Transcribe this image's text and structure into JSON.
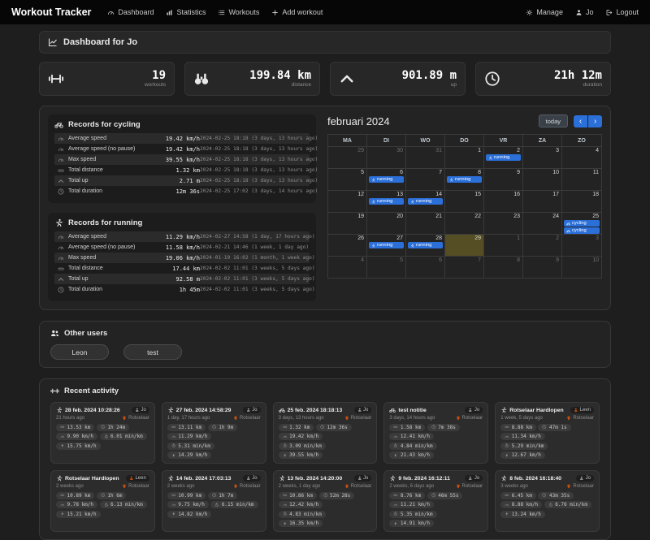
{
  "colors": {
    "accent": "#2b6fd9",
    "today_bg": "#554d23",
    "orange": "#e8590c",
    "navbar_bg": "#060606"
  },
  "navbar": {
    "brand": "Workout Tracker",
    "items": [
      {
        "label": "Dashboard",
        "icon": "gauge-icon"
      },
      {
        "label": "Statistics",
        "icon": "bar-chart-icon"
      },
      {
        "label": "Workouts",
        "icon": "list-icon"
      },
      {
        "label": "Add workout",
        "icon": "plus-icon"
      }
    ],
    "right_items": [
      {
        "label": "Manage",
        "icon": "gear-icon"
      },
      {
        "label": "Jo",
        "icon": "person-icon"
      },
      {
        "label": "Logout",
        "icon": "logout-icon"
      }
    ]
  },
  "page_header": {
    "title": "Dashboard for Jo",
    "icon": "chart-line-icon"
  },
  "stats": [
    {
      "icon": "dumbbell-icon",
      "value": "19",
      "label": "workouts"
    },
    {
      "icon": "binoculars-icon",
      "value": "199.84 km",
      "label": "distance"
    },
    {
      "icon": "chevron-up-icon",
      "value": "901.89 m",
      "label": "up"
    },
    {
      "icon": "clock-icon",
      "value": "21h 12m",
      "label": "duration"
    }
  ],
  "records": [
    {
      "title": "Records for cycling",
      "icon": "bike-icon",
      "rows": [
        {
          "icon": "gauge-icon",
          "label": "Average speed",
          "value": "19.42 km/h",
          "when": "2024-02-25 18:18 (3 days, 13 hours ago)"
        },
        {
          "icon": "gauge-icon",
          "label": "Average speed (no pause)",
          "value": "19.42 km/h",
          "when": "2024-02-25 18:18 (3 days, 13 hours ago)"
        },
        {
          "icon": "gauge-icon",
          "label": "Max speed",
          "value": "39.55 km/h",
          "when": "2024-02-25 18:18 (3 days, 13 hours ago)"
        },
        {
          "icon": "ruler-icon",
          "label": "Total distance",
          "value": "1.32 km",
          "when": "2024-02-25 18:18 (3 days, 13 hours ago)"
        },
        {
          "icon": "chevron-up-icon",
          "label": "Total up",
          "value": "2.71 m",
          "when": "2024-02-25 18:18 (3 days, 13 hours ago)"
        },
        {
          "icon": "clock-icon",
          "label": "Total duration",
          "value": "12m 36s",
          "when": "2024-02-25 17:02 (3 days, 14 hours ago)"
        }
      ]
    },
    {
      "title": "Records for running",
      "icon": "runner-icon",
      "rows": [
        {
          "icon": "gauge-icon",
          "label": "Average speed",
          "value": "11.29 km/h",
          "when": "2024-02-27 14:58 (1 day, 17 hours ago)"
        },
        {
          "icon": "gauge-icon",
          "label": "Average speed (no pause)",
          "value": "11.58 km/h",
          "when": "2024-02-21 14:46 (1 week, 1 day ago)"
        },
        {
          "icon": "gauge-icon",
          "label": "Max speed",
          "value": "19.06 km/h",
          "when": "2024-01-19 16:02 (1 month, 1 week ago)"
        },
        {
          "icon": "ruler-icon",
          "label": "Total distance",
          "value": "17.44 km",
          "when": "2024-02-02 11:01 (3 weeks, 5 days ago)"
        },
        {
          "icon": "chevron-up-icon",
          "label": "Total up",
          "value": "92.58 m",
          "when": "2024-02-02 11:01 (3 weeks, 5 days ago)"
        },
        {
          "icon": "clock-icon",
          "label": "Total duration",
          "value": "1h 45m",
          "when": "2024-02-02 11:01 (3 weeks, 5 days ago)"
        }
      ]
    }
  ],
  "calendar": {
    "title": "februari 2024",
    "today_label": "today",
    "prev_label": "‹",
    "next_label": "›",
    "weekdays": [
      "MA",
      "DI",
      "WO",
      "DO",
      "VR",
      "ZA",
      "ZO"
    ],
    "days": [
      {
        "day": 29,
        "out": true
      },
      {
        "day": 30,
        "out": true
      },
      {
        "day": 31,
        "out": true
      },
      {
        "day": 1
      },
      {
        "day": 2,
        "events": [
          {
            "icon": "runner-icon",
            "label": "running"
          }
        ]
      },
      {
        "day": 3
      },
      {
        "day": 4
      },
      {
        "day": 5
      },
      {
        "day": 6,
        "events": [
          {
            "icon": "runner-icon",
            "label": "running"
          }
        ]
      },
      {
        "day": 7
      },
      {
        "day": 8,
        "events": [
          {
            "icon": "runner-icon",
            "label": "running"
          }
        ]
      },
      {
        "day": 9
      },
      {
        "day": 10
      },
      {
        "day": 11
      },
      {
        "day": 12
      },
      {
        "day": 13,
        "events": [
          {
            "icon": "runner-icon",
            "label": "running"
          }
        ]
      },
      {
        "day": 14,
        "events": [
          {
            "icon": "runner-icon",
            "label": "running"
          }
        ]
      },
      {
        "day": 15
      },
      {
        "day": 16
      },
      {
        "day": 17
      },
      {
        "day": 18
      },
      {
        "day": 19
      },
      {
        "day": 20
      },
      {
        "day": 21
      },
      {
        "day": 22
      },
      {
        "day": 23
      },
      {
        "day": 24
      },
      {
        "day": 25,
        "events": [
          {
            "icon": "bike-icon",
            "label": "cycling"
          },
          {
            "icon": "bike-icon",
            "label": "cycling"
          }
        ]
      },
      {
        "day": 26
      },
      {
        "day": 27,
        "events": [
          {
            "icon": "runner-icon",
            "label": "running"
          }
        ]
      },
      {
        "day": 28,
        "events": [
          {
            "icon": "runner-icon",
            "label": "running"
          }
        ]
      },
      {
        "day": 29,
        "today": true
      },
      {
        "day": 1,
        "out": true
      },
      {
        "day": 2,
        "out": true
      },
      {
        "day": 3,
        "out": true
      },
      {
        "day": 4,
        "out": true
      },
      {
        "day": 5,
        "out": true
      },
      {
        "day": 6,
        "out": true
      },
      {
        "day": 7,
        "out": true
      },
      {
        "day": 8,
        "out": true
      },
      {
        "day": 9,
        "out": true
      },
      {
        "day": 10,
        "out": true
      }
    ]
  },
  "other_users": {
    "title": "Other users",
    "icon": "people-icon",
    "users": [
      "Leon",
      "test"
    ]
  },
  "recent": {
    "title": "Recent activity",
    "icon": "dumbbell-icon",
    "cards": [
      {
        "type_icon": "runner-icon",
        "title": "28 feb. 2024 10:28:26",
        "user": "Jo",
        "user_color": "#b0b0b0",
        "ago": "21 hours ago",
        "location": "Rotselaar",
        "chips": [
          {
            "icon": "ruler-icon",
            "text": "13.53 km"
          },
          {
            "icon": "clock-icon",
            "text": "1h 24m"
          },
          {
            "icon": "gauge-icon",
            "text": "9.90 km/h"
          },
          {
            "icon": "stopwatch-icon",
            "text": "6.01 min/km"
          },
          {
            "icon": "bolt-icon",
            "text": "15.75 km/h"
          }
        ]
      },
      {
        "type_icon": "runner-icon",
        "title": "27 feb. 2024 14:58:29",
        "user": "Jo",
        "user_color": "#b0b0b0",
        "ago": "1 day, 17 hours ago",
        "location": "Rotselaar",
        "chips": [
          {
            "icon": "ruler-icon",
            "text": "13.11 km"
          },
          {
            "icon": "clock-icon",
            "text": "1h 9m"
          },
          {
            "icon": "gauge-icon",
            "text": "11.29 km/h"
          },
          {
            "icon": "stopwatch-icon",
            "text": "5.31 min/km"
          },
          {
            "icon": "bolt-icon",
            "text": "14.29 km/h"
          }
        ]
      },
      {
        "type_icon": "bike-icon",
        "title": "25 feb. 2024 18:18:13",
        "user": "Jo",
        "user_color": "#b0b0b0",
        "ago": "3 days, 13 hours ago",
        "location": "Rotselaar",
        "chips": [
          {
            "icon": "ruler-icon",
            "text": "1.32 km"
          },
          {
            "icon": "clock-icon",
            "text": "12m 36s"
          },
          {
            "icon": "gauge-icon",
            "text": "19.42 km/h"
          },
          {
            "icon": "stopwatch-icon",
            "text": "3.09 min/km"
          },
          {
            "icon": "bolt-icon",
            "text": "39.55 km/h"
          }
        ]
      },
      {
        "type_icon": "bike-icon",
        "title": "test notitie",
        "user": "Jo",
        "user_color": "#b0b0b0",
        "ago": "3 days, 14 hours ago",
        "location": "Rotselaar",
        "chips": [
          {
            "icon": "ruler-icon",
            "text": "1.58 km"
          },
          {
            "icon": "clock-icon",
            "text": "7m 38s"
          },
          {
            "icon": "gauge-icon",
            "text": "12.41 km/h"
          },
          {
            "icon": "stopwatch-icon",
            "text": "4.84 min/km"
          },
          {
            "icon": "bolt-icon",
            "text": "21.43 km/h"
          }
        ]
      },
      {
        "type_icon": "runner-icon",
        "title": "Rotselaar Hardlopen",
        "user": "Leen",
        "user_color": "#e8590c",
        "ago": "1 week, 5 days ago",
        "location": "Rotselaar",
        "chips": [
          {
            "icon": "ruler-icon",
            "text": "8.88 km"
          },
          {
            "icon": "clock-icon",
            "text": "47m 1s"
          },
          {
            "icon": "gauge-icon",
            "text": "11.34 km/h"
          },
          {
            "icon": "stopwatch-icon",
            "text": "5.29 min/km"
          },
          {
            "icon": "bolt-icon",
            "text": "12.67 km/h"
          }
        ]
      },
      {
        "type_icon": "runner-icon",
        "title": "Rotselaar Hardlopen",
        "user": "Leen",
        "user_color": "#e8590c",
        "ago": "2 weeks ago",
        "location": "Rotselaar",
        "chips": [
          {
            "icon": "ruler-icon",
            "text": "10.89 km"
          },
          {
            "icon": "clock-icon",
            "text": "1h 6m"
          },
          {
            "icon": "gauge-icon",
            "text": "9.78 km/h"
          },
          {
            "icon": "stopwatch-icon",
            "text": "6.13 min/km"
          },
          {
            "icon": "bolt-icon",
            "text": "15.21 km/h"
          }
        ]
      },
      {
        "type_icon": "runner-icon",
        "title": "14 feb. 2024 17:03:13",
        "user": "Jo",
        "user_color": "#b0b0b0",
        "ago": "2 weeks ago",
        "location": "Rotselaar",
        "chips": [
          {
            "icon": "ruler-icon",
            "text": "10.99 km"
          },
          {
            "icon": "clock-icon",
            "text": "1h 7m"
          },
          {
            "icon": "gauge-icon",
            "text": "9.75 km/h"
          },
          {
            "icon": "stopwatch-icon",
            "text": "6.15 min/km"
          },
          {
            "icon": "bolt-icon",
            "text": "14.82 km/h"
          }
        ]
      },
      {
        "type_icon": "runner-icon",
        "title": "13 feb. 2024 14:20:00",
        "user": "Jo",
        "user_color": "#b0b0b0",
        "ago": "2 weeks, 1 day ago",
        "location": "Rotselaar",
        "chips": [
          {
            "icon": "ruler-icon",
            "text": "10.86 km"
          },
          {
            "icon": "clock-icon",
            "text": "52m 28s"
          },
          {
            "icon": "gauge-icon",
            "text": "12.42 km/h"
          },
          {
            "icon": "stopwatch-icon",
            "text": "4.83 min/km"
          },
          {
            "icon": "bolt-icon",
            "text": "16.35 km/h"
          }
        ]
      },
      {
        "type_icon": "runner-icon",
        "title": "9 feb. 2024 16:12:11",
        "user": "Jo",
        "user_color": "#b0b0b0",
        "ago": "2 weeks, 6 days ago",
        "location": "Rotselaar",
        "chips": [
          {
            "icon": "ruler-icon",
            "text": "8.76 km"
          },
          {
            "icon": "clock-icon",
            "text": "46m 55s"
          },
          {
            "icon": "gauge-icon",
            "text": "11.21 km/h"
          },
          {
            "icon": "stopwatch-icon",
            "text": "5.35 min/km"
          },
          {
            "icon": "bolt-icon",
            "text": "14.91 km/h"
          }
        ]
      },
      {
        "type_icon": "runner-icon",
        "title": "8 feb. 2024 16:18:40",
        "user": "Jo",
        "user_color": "#b0b0b0",
        "ago": "3 weeks ago",
        "location": "Rotselaar",
        "chips": [
          {
            "icon": "ruler-icon",
            "text": "6.45 km"
          },
          {
            "icon": "clock-icon",
            "text": "43m 35s"
          },
          {
            "icon": "gauge-icon",
            "text": "8.88 km/h"
          },
          {
            "icon": "stopwatch-icon",
            "text": "6.76 min/km"
          },
          {
            "icon": "bolt-icon",
            "text": "13.24 km/h"
          }
        ]
      }
    ]
  }
}
